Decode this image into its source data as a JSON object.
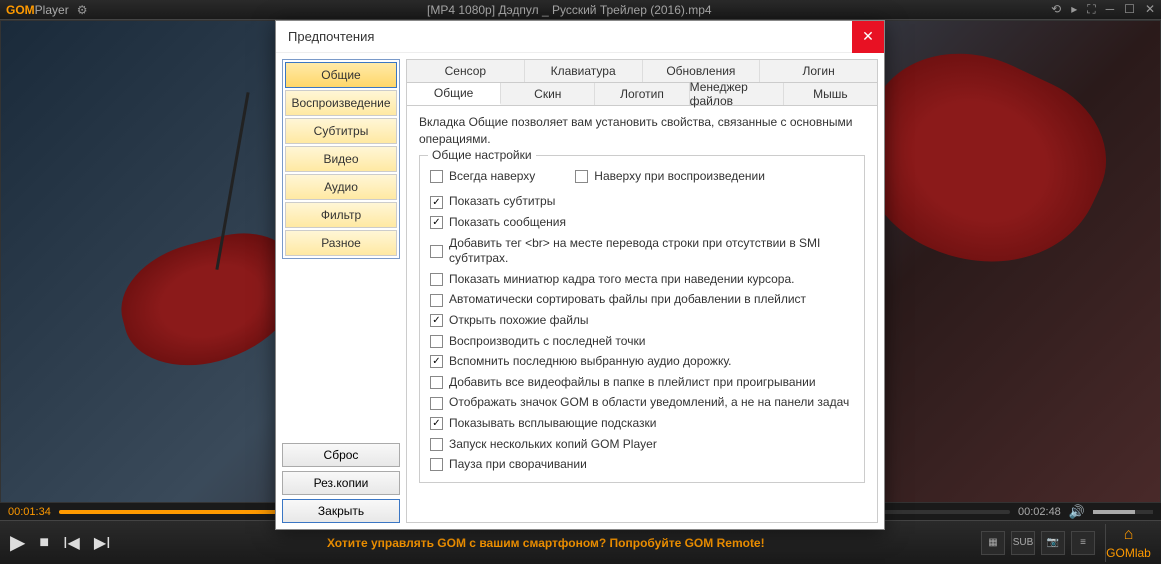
{
  "app": {
    "logo_g": "GOM",
    "logo_player": "Player",
    "file": "[MP4 1080p] Дэдпул _ Русский Трейлер (2016).mp4",
    "promo": "Хотите управлять GOM с вашим смартфоном? Попробуйте GOM Remote!",
    "gomlab": "GOMlab"
  },
  "time": {
    "current": "00:01:34",
    "total": "00:02:48"
  },
  "dialog": {
    "title": "Предпочтения",
    "sidebar": {
      "items": [
        {
          "label": "Общие"
        },
        {
          "label": "Воспроизведение"
        },
        {
          "label": "Субтитры"
        },
        {
          "label": "Видео"
        },
        {
          "label": "Аудио"
        },
        {
          "label": "Фильтр"
        },
        {
          "label": "Разное"
        }
      ],
      "reset": "Сброс",
      "backup": "Рез.копии",
      "close": "Закрыть"
    },
    "tabs_top": [
      {
        "label": "Сенсор"
      },
      {
        "label": "Клавиатура"
      },
      {
        "label": "Обновления"
      },
      {
        "label": "Логин"
      }
    ],
    "tabs_bottom": [
      {
        "label": "Общие"
      },
      {
        "label": "Скин"
      },
      {
        "label": "Логотип"
      },
      {
        "label": "Менеджер файлов"
      },
      {
        "label": "Мышь"
      }
    ],
    "desc": "Вкладка Общие позволяет вам установить свойства, связанные с основными операциями.",
    "fieldset_title": "Общие настройки",
    "checks": [
      {
        "label": "Всегда наверху",
        "checked": false
      },
      {
        "label": "Наверху при воспроизведении",
        "checked": false
      },
      {
        "label": "Показать субтитры",
        "checked": true
      },
      {
        "label": "Показать сообщения",
        "checked": true
      },
      {
        "label": "Добавить тег <br> на месте перевода строки при отсутствии в SMI субтитрах.",
        "checked": false
      },
      {
        "label": "Показать миниатюр кадра того места при наведении курсора.",
        "checked": false
      },
      {
        "label": "Автоматически сортировать файлы при добавлении в плейлист",
        "checked": false
      },
      {
        "label": "Открыть похожие файлы",
        "checked": true
      },
      {
        "label": "Воспроизводить с последней точки",
        "checked": false
      },
      {
        "label": "Вспомнить последнюю выбранную аудио дорожку.",
        "checked": true
      },
      {
        "label": "Добавить все видеофайлы в папке в плейлист при проигрывании",
        "checked": false
      },
      {
        "label": "Отображать значок GOM в области уведомлений, а не на панели задач",
        "checked": false
      },
      {
        "label": "Показывать всплывающие подсказки",
        "checked": true
      },
      {
        "label": "Запуск нескольких копий GOM Player",
        "checked": false
      },
      {
        "label": "Пауза при сворачивании",
        "checked": false
      }
    ]
  }
}
